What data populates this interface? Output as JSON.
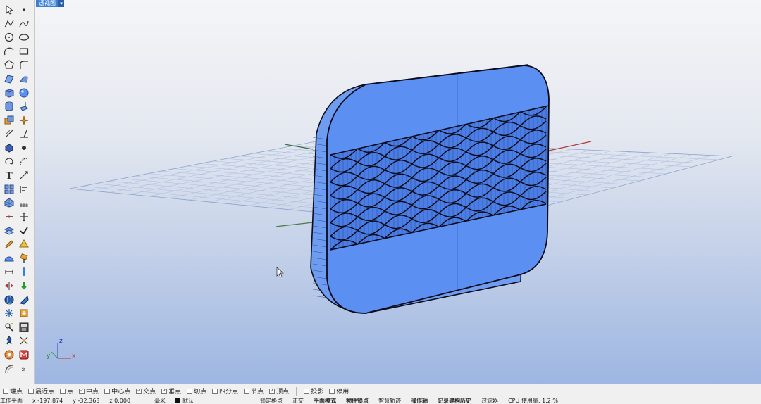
{
  "viewport": {
    "title": "透视图",
    "menu_arrow": "▾",
    "axis_labels": {
      "x": "x",
      "y": "y",
      "z": "z"
    }
  },
  "toolbar": {
    "collapse_arrow": "»",
    "rows": [
      [
        "select-arrow-icon",
        "point-icon"
      ],
      [
        "polyline-icon",
        "curve-icon"
      ],
      [
        "circle-icon",
        "ellipse-icon"
      ],
      [
        "arc-icon",
        "rectangle-icon"
      ],
      [
        "polygon-icon",
        "fillet-icon"
      ],
      [
        "surface-icon",
        "loft-icon"
      ],
      [
        "box-icon",
        "sphere-icon"
      ],
      [
        "cylinder-icon",
        "extrude-icon"
      ],
      [
        "boolean-icon",
        "explode-icon"
      ],
      [
        "offset-icon",
        "trim-icon"
      ],
      [
        "solid-icon",
        "dot-icon"
      ],
      [
        "rotate-icon",
        "rebuild-icon"
      ],
      [
        "text-icon",
        "dimension-icon"
      ],
      [
        "array-icon",
        "align-icon"
      ],
      [
        "mesh-icon",
        "grid-icon"
      ],
      [
        "join-icon",
        "move-icon"
      ],
      [
        "layer-icon",
        "check-icon"
      ],
      [
        "pen-icon",
        "render-icon"
      ],
      [
        "shade-icon",
        "paint-icon"
      ],
      [
        "link-icon",
        "info-icon"
      ],
      [
        "mirror-icon",
        "arrow-down-icon"
      ],
      [
        "globe-icon",
        "light-icon"
      ],
      [
        "snowflake-icon",
        "transform-icon"
      ],
      [
        "analyze-icon",
        "save-icon"
      ],
      [
        "pin-icon",
        "scale-icon"
      ],
      [
        "camera-icon",
        "plugin-icon"
      ]
    ]
  },
  "osnap": {
    "items": [
      {
        "label": "端点",
        "checked": false
      },
      {
        "label": "最近点",
        "checked": false
      },
      {
        "label": "点",
        "checked": false
      },
      {
        "label": "中点",
        "checked": true
      },
      {
        "label": "中心点",
        "checked": false
      },
      {
        "label": "交点",
        "checked": true
      },
      {
        "label": "垂点",
        "checked": true
      },
      {
        "label": "切点",
        "checked": false
      },
      {
        "label": "四分点",
        "checked": false
      },
      {
        "label": "节点",
        "checked": false
      },
      {
        "label": "顶点",
        "checked": true
      }
    ],
    "project": {
      "label": "投影",
      "checked": false
    },
    "disable": {
      "label": "停用",
      "checked": false
    }
  },
  "status": {
    "cplane": "工作平面",
    "x": "x -197.874",
    "y": "y -32.363",
    "z": "z 0.000",
    "unit": "毫米",
    "layer": "默认",
    "layer_color": "#111111",
    "grid_snap": "锁定格点",
    "ortho": "正交",
    "planar": "平面模式",
    "osnap": "物件锁点",
    "smarttrack": "智慧轨迹",
    "gumball": "操作轴",
    "history": "记录建构历史",
    "filter": "过滤器",
    "cpu": "CPU 使用量: 1.2 %"
  },
  "colors": {
    "accent": "#3a7fd1",
    "object_fill": "#5b8ff2",
    "object_edge": "#0a0a1a"
  }
}
